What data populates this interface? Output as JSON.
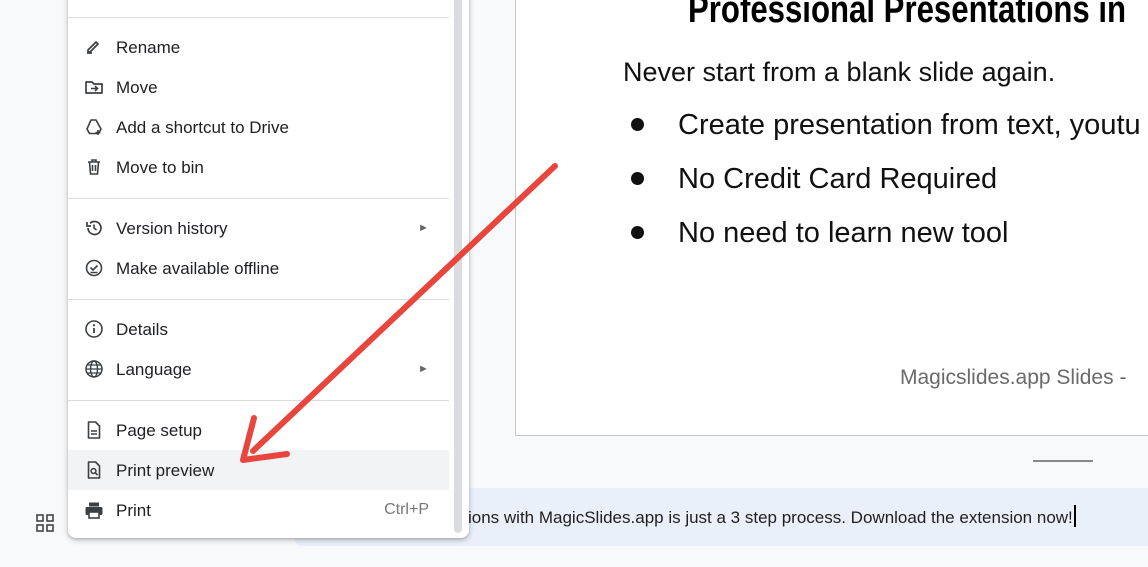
{
  "slide": {
    "title": "Professional Presentations in",
    "subtitle": "Never start from a blank slide again.",
    "bullets": [
      "Create presentation from text, youtu",
      "No Credit Card Required",
      "No need to learn new tool"
    ],
    "footer": "Magicslides.app Slides -"
  },
  "notes": {
    "text": "ions with MagicSlides.app is just a 3 step process. Download the extension now!"
  },
  "menu": {
    "items": [
      {
        "label": "Rename",
        "icon": "rename-icon"
      },
      {
        "label": "Move",
        "icon": "move-folder-icon"
      },
      {
        "label": "Add a shortcut to Drive",
        "icon": "drive-shortcut-icon"
      },
      {
        "label": "Move to bin",
        "icon": "trash-icon"
      },
      {
        "label": "Version history",
        "icon": "history-icon",
        "submenu": true
      },
      {
        "label": "Make available offline",
        "icon": "offline-icon"
      },
      {
        "label": "Details",
        "icon": "info-icon"
      },
      {
        "label": "Language",
        "icon": "globe-icon",
        "submenu": true
      },
      {
        "label": "Page setup",
        "icon": "page-setup-icon"
      },
      {
        "label": "Print preview",
        "icon": "print-preview-icon",
        "highlighted": true
      },
      {
        "label": "Print",
        "icon": "printer-icon",
        "shortcut": "Ctrl+P"
      }
    ],
    "submenu_arrow": "►"
  },
  "colors": {
    "annotation_arrow": "#e8453c",
    "menu_hover": "#f1f3f4",
    "notes_background": "#eaf0fa"
  }
}
